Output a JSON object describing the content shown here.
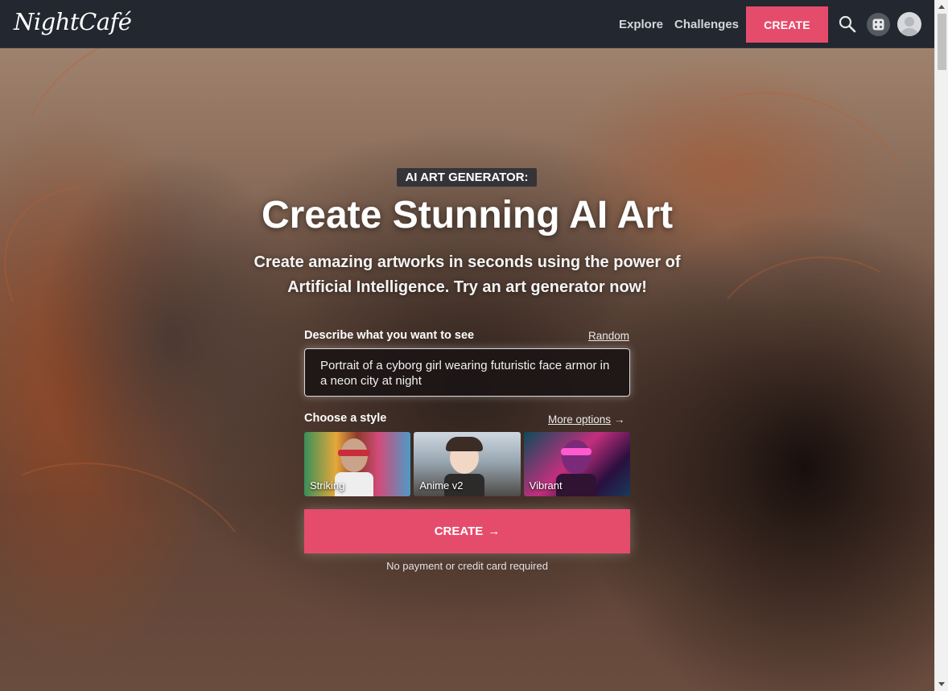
{
  "nav": {
    "logo": "NightCafé",
    "links": [
      "Explore",
      "Challenges"
    ],
    "create_label": "CREATE",
    "icons": [
      "search-icon",
      "dice-icon",
      "avatar-icon"
    ]
  },
  "hero": {
    "eyebrow": "AI ART GENERATOR:",
    "title": "Create Stunning AI Art",
    "subtitle": "Create amazing artworks in seconds using the power of Artificial Intelligence. Try an art generator now!"
  },
  "form": {
    "prompt_label": "Describe what you want to see",
    "random_label": "Random",
    "prompt_value": "Portrait of a cyborg girl wearing futuristic face armor in a neon city at night",
    "style_label": "Choose a style",
    "more_options_label": "More options",
    "styles": [
      "Striking",
      "Anime v2",
      "Vibrant"
    ],
    "create_label": "CREATE",
    "note": "No payment or credit card required"
  },
  "colors": {
    "accent": "#e54c6c",
    "nav_bg": "#23272f"
  }
}
